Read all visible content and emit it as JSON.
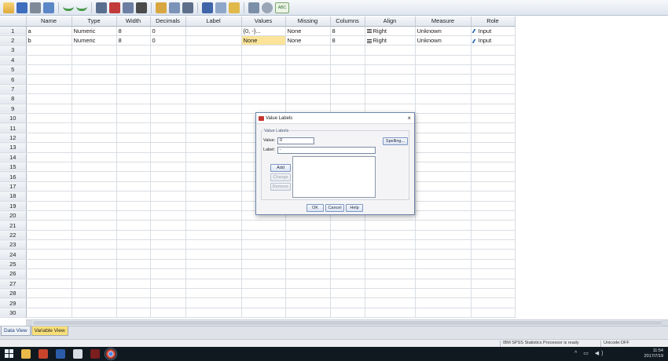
{
  "toolbar": {
    "icons": [
      "open-folder-icon",
      "save-icon",
      "print-icon",
      "recall-dialog-icon",
      "undo-icon",
      "redo-icon",
      "goto-case-icon",
      "goto-variable-icon",
      "variables-icon",
      "find-icon",
      "insert-cases-icon",
      "insert-variable-icon",
      "split-file-icon",
      "weight-cases-icon",
      "select-cases-icon",
      "value-labels-icon",
      "use-sets-icon",
      "show-all-variables-icon",
      "spell-check-icon"
    ],
    "spell_label": "ABC"
  },
  "columns": [
    "Name",
    "Type",
    "Width",
    "Decimals",
    "Label",
    "Values",
    "Missing",
    "Columns",
    "Align",
    "Measure",
    "Role"
  ],
  "rows": [
    {
      "num": "1",
      "name": "a",
      "type": "Numeric",
      "width": "8",
      "decimals": "0",
      "label": "",
      "values": "{0, -}...",
      "missing": "None",
      "columns": "8",
      "align": "Right",
      "measure": "Unknown",
      "role": "Input"
    },
    {
      "num": "2",
      "name": "b",
      "type": "Numeric",
      "width": "8",
      "decimals": "0",
      "label": "",
      "values": "None",
      "missing": "None",
      "columns": "8",
      "align": "Right",
      "measure": "Unknown",
      "role": "Input"
    }
  ],
  "empty_row_numbers": [
    "3",
    "4",
    "5",
    "6",
    "7",
    "8",
    "9",
    "10",
    "11",
    "12",
    "13",
    "14",
    "15",
    "16",
    "17",
    "18",
    "19",
    "20",
    "21",
    "22",
    "23",
    "24",
    "25",
    "26",
    "27",
    "28",
    "29",
    "30"
  ],
  "dialog": {
    "title": "Value Labels",
    "group_label": "Value Labels",
    "value_label": "Value:",
    "value_input": "0",
    "label_label": "Label:",
    "label_input": "-",
    "spelling_button": "Spelling...",
    "add_button": "Add",
    "change_button": "Change",
    "remove_button": "Remove",
    "ok_button": "OK",
    "cancel_button": "Cancel",
    "help_button": "Help",
    "close_glyph": "×"
  },
  "tabs": [
    {
      "label": "Data View",
      "active": false
    },
    {
      "label": "Variable View",
      "active": true
    }
  ],
  "status": {
    "processor": "IBM SPSS Statistics Processor is ready",
    "unicode": "Unicode:OFF"
  },
  "taskbar": {
    "icons": [
      "start-icon",
      "file-explorer-icon",
      "powerpoint-icon",
      "word-icon",
      "photos-icon",
      "spss-icon",
      "chrome-icon"
    ],
    "tray_icons": "^ ▭ ◀)",
    "time": "11:54",
    "date": "2017/7/19"
  },
  "colors": {
    "selected_cell": "#fbe49a",
    "active_tab": "#f9df7a",
    "dialog_border": "#6f88ad"
  }
}
